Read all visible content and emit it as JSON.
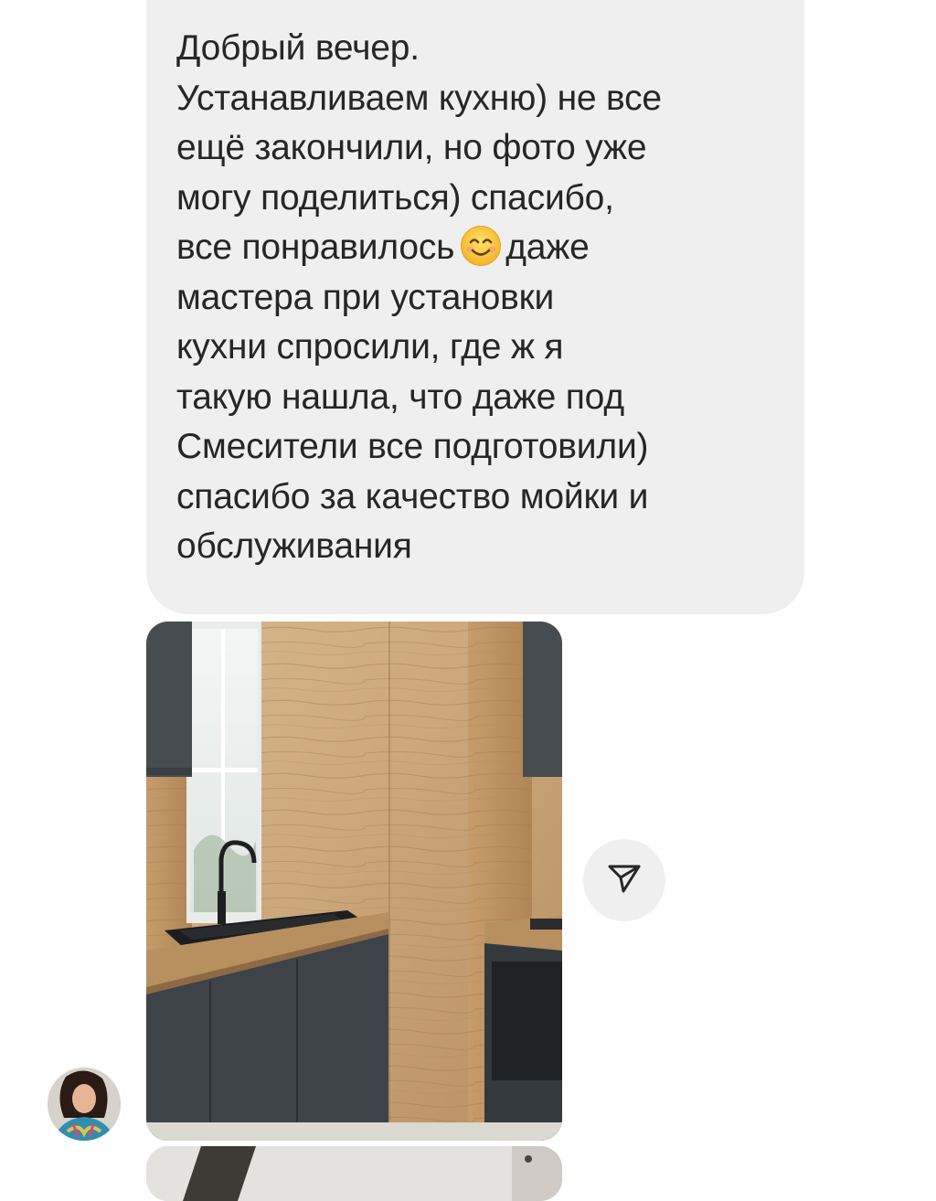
{
  "message": {
    "lines": [
      "Добрый вечер.",
      "Устанавливаем кухню) не все",
      "ещё закончили, но фото уже",
      "могу поделиться) спасибо,",
      "даже",
      "мастера при установки",
      "кухни спросили, где ж я",
      "такую нашла, что даже под",
      "Смесители все подготовили)",
      "спасибо за качество мойки и",
      "обслуживания"
    ],
    "emoji_line_prefix": "все понравилось",
    "emoji_icon": "smiling-face-icon"
  },
  "share_icon": "paper-plane-icon",
  "colors": {
    "bubble": "#efefef",
    "text": "#262626",
    "background": "#ffffff"
  }
}
